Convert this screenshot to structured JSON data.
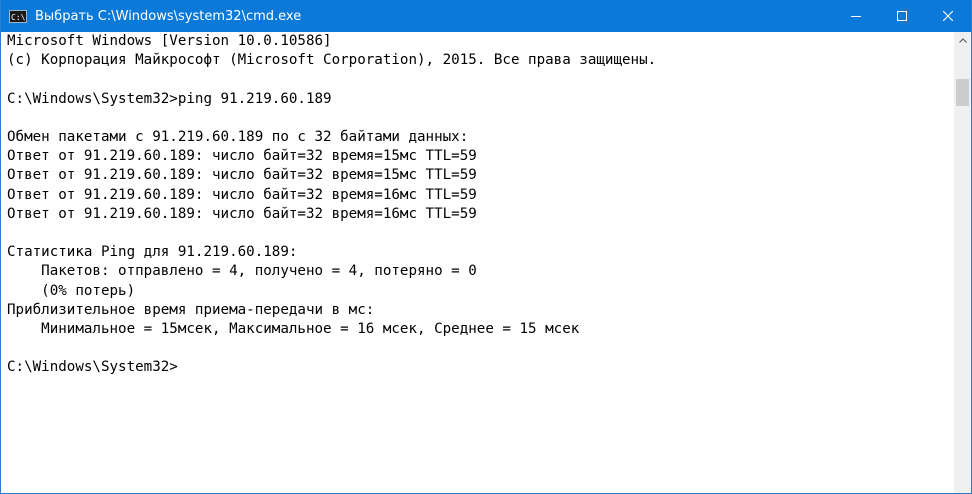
{
  "window": {
    "title": "Выбрать C:\\Windows\\system32\\cmd.exe",
    "icon": "cmd-icon",
    "icon_text": "C:\\",
    "controls": [
      "minimize-icon",
      "maximize-icon",
      "close-icon"
    ]
  },
  "console": {
    "lines": [
      "Microsoft Windows [Version 10.0.10586]",
      "(c) Корпорация Майкрософт (Microsoft Corporation), 2015. Все права защищены.",
      "",
      "C:\\Windows\\System32>ping 91.219.60.189",
      "",
      "Обмен пакетами с 91.219.60.189 по с 32 байтами данных:",
      "Ответ от 91.219.60.189: число байт=32 время=15мс TTL=59",
      "Ответ от 91.219.60.189: число байт=32 время=15мс TTL=59",
      "Ответ от 91.219.60.189: число байт=32 время=16мс TTL=59",
      "Ответ от 91.219.60.189: число байт=32 время=16мс TTL=59",
      "",
      "Статистика Ping для 91.219.60.189:",
      "    Пакетов: отправлено = 4, получено = 4, потеряно = 0",
      "    (0% потерь)",
      "Приблизительное время приема-передачи в мс:",
      "    Минимальное = 15мсек, Максимальное = 16 мсек, Среднее = 15 мсек",
      "",
      "C:\\Windows\\System32>"
    ]
  },
  "colors": {
    "titlebar": "#0b79d8",
    "console_bg": "#ffffff",
    "console_text": "#000000"
  }
}
